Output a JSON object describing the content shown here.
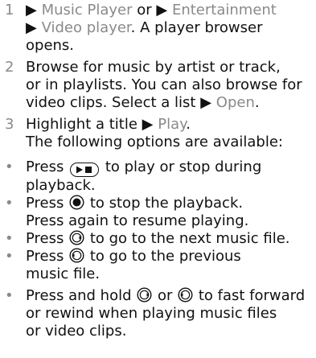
{
  "steps": [
    {
      "num": "1",
      "parts": [
        {
          "t": "",
          "sep": "▶ "
        },
        {
          "t": "Music Player",
          "menu": false
        },
        {
          "t": " or ",
          "menu": false
        },
        {
          "sep": "▶ "
        },
        {
          "t": "Entertainment",
          "menu": false
        },
        {
          "sep": "▶ "
        },
        {
          "t": "Video player",
          "menu": false
        },
        {
          "t": ". A player browser opens.",
          "menu": false
        }
      ],
      "l1": {
        "a": "Music Player",
        "b": " or ",
        "c": "Entertainment"
      },
      "l2": {
        "a": "Video player",
        "b": ". A player browser"
      },
      "l3": "opens."
    },
    {
      "num": "2",
      "l1": "Browse for music by artist or track,",
      "l2": "or in playlists. You can also browse for",
      "l3a": "video clips. Select a list ",
      "l3b": "Open",
      "l3c": "."
    },
    {
      "num": "3",
      "l1a": "Highlight a title ",
      "l1b": "Play",
      "l1c": ".",
      "l2": "The following options are available:"
    }
  ],
  "arrow": "▶",
  "bullet_char": "•",
  "bullets": {
    "b1": {
      "a": "Press ",
      "b": " to play or stop during",
      "c": "playback."
    },
    "b2": {
      "a": "Press ",
      "b": " to stop the playback.",
      "c": "Press again to resume playing."
    },
    "b3": {
      "a": "Press ",
      "b": " to go to the next music file."
    },
    "b4": {
      "a": "Press ",
      "b": " to go to the previous",
      "c": "music file."
    },
    "b5": {
      "a": "Press and hold ",
      "b": " or ",
      "c": " to fast forward",
      "d": "or rewind when playing music files",
      "e": "or video clips."
    }
  },
  "colors": {
    "text": "#111111",
    "menu": "#8a8a8a"
  },
  "icons": [
    "play-pause-key-icon",
    "stop-key-icon",
    "next-key-icon",
    "previous-key-icon"
  ]
}
